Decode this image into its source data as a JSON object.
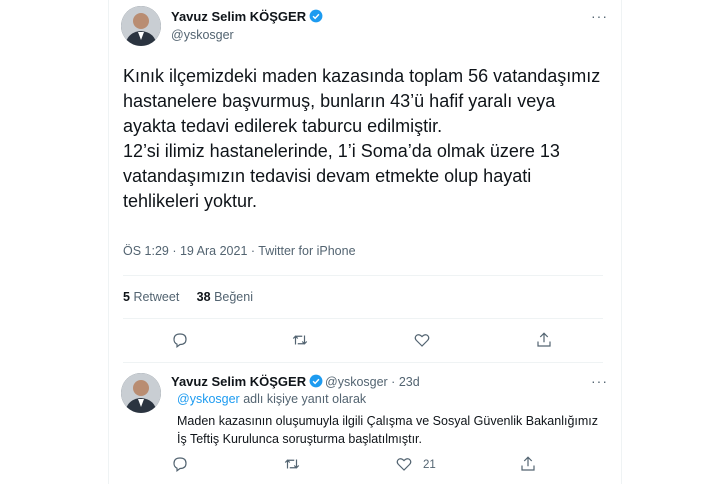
{
  "tweet": {
    "author_name": "Yavuz Selim KÖŞGER",
    "handle": "@yskosger",
    "more_icon": "more-icon",
    "text": "Kınık ilçemizdeki maden kazasında toplam 56 vatandaşımız hastanelere başvurmuş, bunların 43’ü hafif yaralı veya ayakta tedavi edilerek taburcu edilmiştir.\n12’si ilimiz hastanelerinde, 1’i Soma’da olmak üzere 13 vatandaşımızın tedavisi devam etmekte olup hayati tehlikeleri yoktur.",
    "time": "ÖS 1:29 · 19 Ara 2021 · Twitter for iPhone",
    "retweets_count": "5",
    "retweets_label": "Retweet",
    "likes_count": "38",
    "likes_label": "Beğeni"
  },
  "reply": {
    "author_name": "Yavuz Selim KÖŞGER",
    "handle": "@yskosger · 23d",
    "replying_mention": "@yskosger",
    "replying_suffix": " adlı kişiye yanıt olarak",
    "text": "Maden kazasının oluşumuyla ilgili Çalışma ve Sosyal Güvenlik Bakanlığımız\nİş Teftiş Kurulunca soruşturma başlatılmıştır.",
    "like_count": "21"
  },
  "colors": {
    "verified": "#1d9bf0",
    "text": "#0f1419",
    "muted": "#536471"
  }
}
